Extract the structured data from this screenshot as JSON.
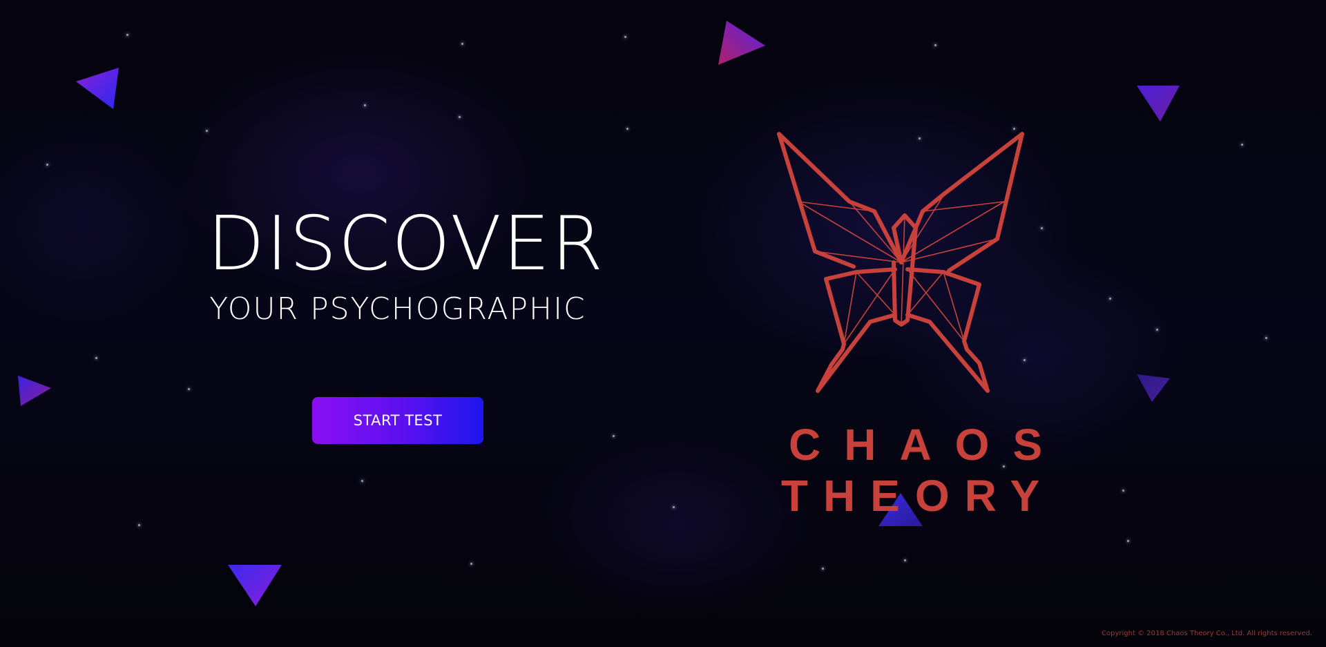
{
  "hero": {
    "title": "DISCOVER",
    "subtitle": "YOUR PSYCHOGRAPHIC",
    "cta_label": "START TEST"
  },
  "logo": {
    "line1": "CHAOS",
    "line2": "THEORY",
    "icon": "origami-butterfly-icon"
  },
  "footer": {
    "copyright": "Copyright © 2018 Chaos Theory Co., Ltd. All rights reserved."
  },
  "colors": {
    "background": "#04030b",
    "brand_red": "#c9413b",
    "button_gradient_start": "#8a0ff2",
    "button_gradient_end": "#1d16ee",
    "triangle_purple": "#6a1fd9",
    "triangle_blue": "#2a2af0"
  }
}
